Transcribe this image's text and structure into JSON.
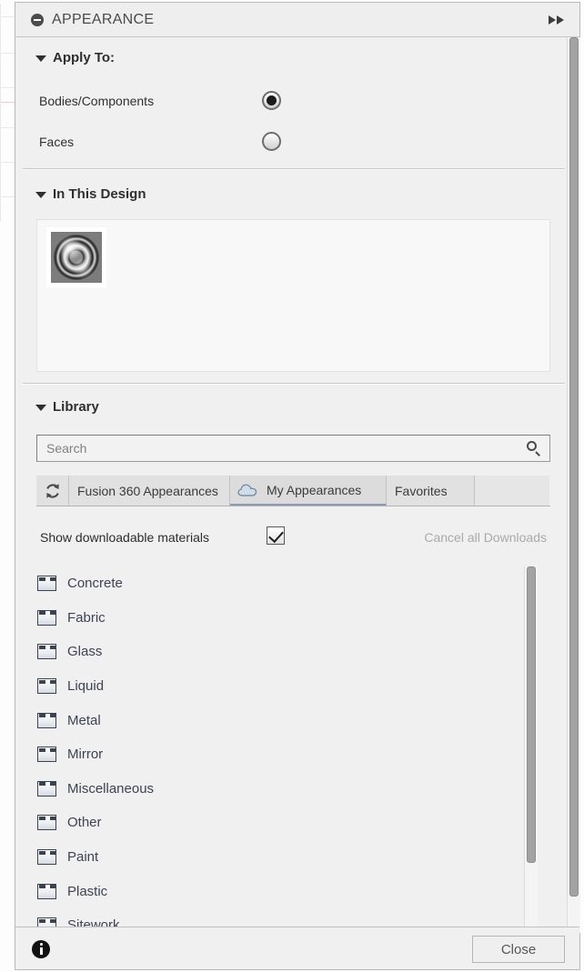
{
  "panel": {
    "title": "APPEARANCE",
    "collapse_icon": "minus-circle-icon",
    "expand_icon": "double-right-arrow-icon"
  },
  "apply_to": {
    "heading": "Apply To:",
    "options": [
      {
        "label": "Bodies/Components",
        "selected": true
      },
      {
        "label": "Faces",
        "selected": false
      }
    ]
  },
  "in_this_design": {
    "heading": "In This Design",
    "swatches": [
      {
        "name": "chrome-appearance-swatch"
      }
    ]
  },
  "library": {
    "heading": "Library",
    "search": {
      "value": "",
      "placeholder": "Search",
      "icon": "search-icon"
    },
    "tabs": [
      {
        "label": "",
        "icon": "refresh-icon",
        "active": false,
        "kind": "icon"
      },
      {
        "label": "Fusion 360 Appearances",
        "icon": "",
        "active": false,
        "kind": "text"
      },
      {
        "label": "My Appearances",
        "icon": "cloud-icon",
        "active": true,
        "kind": "text"
      },
      {
        "label": "Favorites",
        "icon": "",
        "active": false,
        "kind": "text"
      }
    ],
    "show_downloadable_label": "Show downloadable materials",
    "show_downloadable_checked": true,
    "cancel_downloads_label": "Cancel all Downloads",
    "cancel_downloads_disabled": true,
    "folders": [
      {
        "label": "Concrete"
      },
      {
        "label": "Fabric"
      },
      {
        "label": "Glass"
      },
      {
        "label": "Liquid"
      },
      {
        "label": "Metal"
      },
      {
        "label": "Mirror"
      },
      {
        "label": "Miscellaneous"
      },
      {
        "label": "Other"
      },
      {
        "label": "Paint"
      },
      {
        "label": "Plastic"
      },
      {
        "label": "Sitework"
      }
    ]
  },
  "footer": {
    "info_icon": "info-icon",
    "close_label": "Close"
  },
  "colors": {
    "panel_bg": "#f0f0f0",
    "title_text": "#4a4a4a",
    "folder_text": "#3b4454",
    "disabled_text": "#aaaaaa",
    "tab_active_underline": "#8e9bb2"
  }
}
